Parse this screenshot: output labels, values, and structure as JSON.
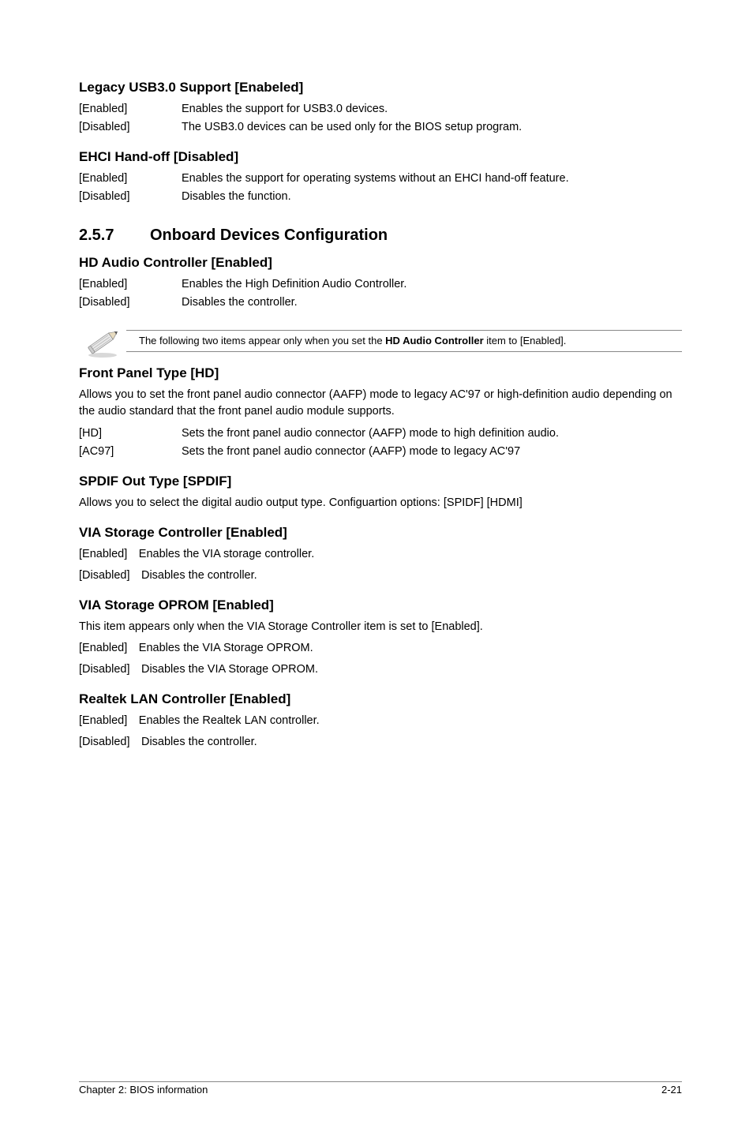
{
  "s1": {
    "title": "Legacy USB3.0 Support [Enabeled]",
    "enabled": "Enables the support for USB3.0 devices.",
    "disabled": "The USB3.0 devices can be used only for the BIOS setup program."
  },
  "s2": {
    "title": "EHCI Hand-off [Disabled]",
    "enabled": "Enables the support for operating systems without an EHCI hand-off feature.",
    "disabled": "Disables the function."
  },
  "section": {
    "num": "2.5.7",
    "title": "Onboard Devices Configuration"
  },
  "s3": {
    "title": "HD Audio Controller [Enabled]",
    "enabled": "Enables the High Definition Audio Controller.",
    "disabled": "Disables the controller."
  },
  "note": {
    "text_pre": "The following two items appear only when you set the ",
    "bold": "HD Audio Controller",
    "text_post": " item to [Enabled]."
  },
  "s4": {
    "title": "Front Panel Type [HD]",
    "intro": "Allows you to set the front panel audio connector (AAFP) mode to legacy AC'97 or high-definition audio depending on the audio standard that the front panel audio module supports.",
    "hd": "Sets the front panel audio connector (AAFP) mode to high definition audio.",
    "ac97": "Sets the front panel audio connector (AAFP) mode to legacy AC'97"
  },
  "s5": {
    "title": "SPDIF Out Type [SPDIF]",
    "body": "Allows you to select the digital audio output type. Configuartion options: [SPIDF] [HDMI]"
  },
  "s6": {
    "title": "VIA Storage Controller [Enabled]",
    "enabled": "[Enabled] Enables the VIA storage controller.",
    "disabled": "[Disabled] Disables the controller."
  },
  "s7": {
    "title": "VIA Storage OPROM [Enabled]",
    "intro": "This item appears only when the VIA Storage Controller item is set to [Enabled].",
    "enabled": "[Enabled] Enables the VIA Storage OPROM.",
    "disabled": "[Disabled] Disables the VIA Storage OPROM."
  },
  "s8": {
    "title": "Realtek LAN Controller [Enabled]",
    "enabled": "[Enabled] Enables the Realtek LAN controller.",
    "disabled": "[Disabled] Disables the controller."
  },
  "labels": {
    "enabled": "[Enabled]",
    "disabled": "[Disabled]",
    "hd": "[HD]",
    "ac97": "[AC97]"
  },
  "footer": {
    "left": "Chapter 2: BIOS information",
    "right": "2-21"
  }
}
